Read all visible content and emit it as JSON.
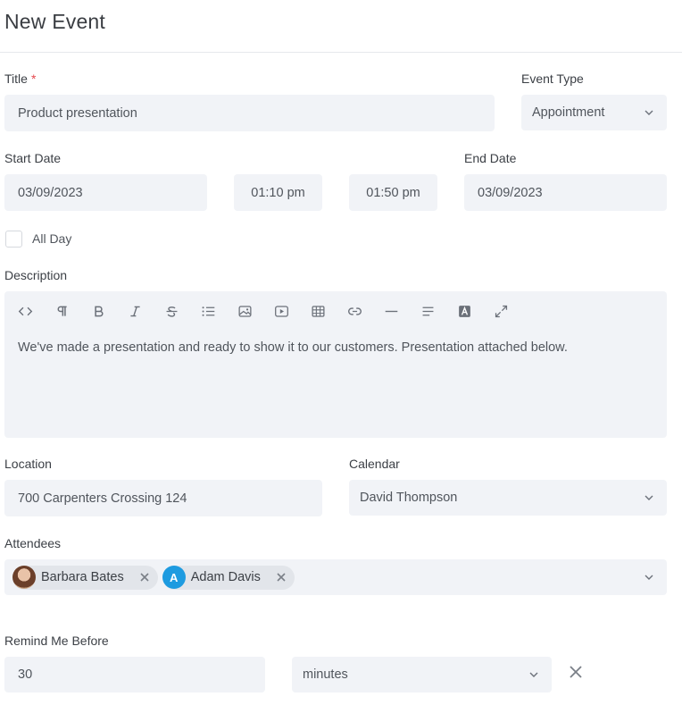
{
  "page": {
    "title": "New Event"
  },
  "form": {
    "title": {
      "label": "Title",
      "required_mark": "*",
      "value": "Product presentation"
    },
    "event_type": {
      "label": "Event Type",
      "value": "Appointment"
    },
    "start_date": {
      "label": "Start Date",
      "date": "03/09/2023",
      "time": "01:10 pm"
    },
    "end_date": {
      "label": "End Date",
      "date": "03/09/2023",
      "time": "01:50 pm"
    },
    "all_day": {
      "label": "All Day",
      "checked": false
    },
    "description": {
      "label": "Description",
      "text": "We've made a presentation and ready to show it to our customers. Presentation attached below.",
      "toolbar": [
        "code-view-icon",
        "paragraph-icon",
        "bold-icon",
        "italic-icon",
        "strikethrough-icon",
        "bullet-list-icon",
        "image-icon",
        "video-icon",
        "table-icon",
        "link-icon",
        "horizontal-rule-icon",
        "align-icon",
        "text-color-icon",
        "fullscreen-icon"
      ]
    },
    "location": {
      "label": "Location",
      "value": "700 Carpenters Crossing 124"
    },
    "calendar": {
      "label": "Calendar",
      "value": "David Thompson"
    },
    "attendees": {
      "label": "Attendees",
      "items": [
        {
          "name": "Barbara Bates",
          "avatar": "photo"
        },
        {
          "name": "Adam Davis",
          "initial": "A",
          "color": "#1e9be0"
        }
      ]
    },
    "remind": {
      "label": "Remind Me Before",
      "value": "30",
      "unit": "minutes"
    }
  },
  "colors": {
    "field_bg": "#f1f3f7",
    "required": "#e5484d",
    "chip_bg": "#e2e5ea",
    "accent": "#1e9be0"
  }
}
